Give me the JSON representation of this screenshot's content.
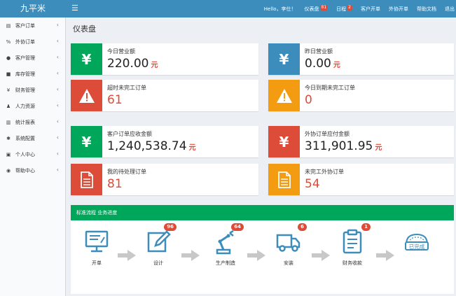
{
  "app": {
    "logo": "九平米"
  },
  "topbar": {
    "menu_icon": "hamburger-icon",
    "greeting": "Hello，李仕！",
    "items": [
      {
        "label": "仪表盘",
        "badge": "81"
      },
      {
        "label": "日程",
        "badge": "2"
      },
      {
        "label": "客户开单",
        "badge": ""
      },
      {
        "label": "外协开单",
        "badge": ""
      },
      {
        "label": "帮助文档",
        "badge": ""
      },
      {
        "label": "退出",
        "badge": ""
      }
    ]
  },
  "sidebar": {
    "items": [
      {
        "label": "客户订单",
        "icon": "file-icon"
      },
      {
        "label": "外协订单",
        "icon": "link-icon"
      },
      {
        "label": "客户管理",
        "icon": "user-icon"
      },
      {
        "label": "库存管理",
        "icon": "box-icon"
      },
      {
        "label": "财务管理",
        "icon": "yen-icon"
      },
      {
        "label": "人力资源",
        "icon": "users-icon"
      },
      {
        "label": "统计报表",
        "icon": "report-icon"
      },
      {
        "label": "系统配置",
        "icon": "gear-icon"
      },
      {
        "label": "个人中心",
        "icon": "card-icon"
      },
      {
        "label": "帮助中心",
        "icon": "help-icon"
      }
    ]
  },
  "page": {
    "title": "仪表盘"
  },
  "stats": {
    "today_revenue": {
      "label": "今日营业额",
      "value": "220.00",
      "unit": "元"
    },
    "yesterday_revenue": {
      "label": "昨日营业额",
      "value": "0.00",
      "unit": "元"
    },
    "overdue_orders": {
      "label": "超时未完工订单",
      "value": "61"
    },
    "due_today_orders": {
      "label": "今日到期未完工订单",
      "value": "0"
    },
    "receivable": {
      "label": "客户订单应收金额",
      "value": "1,240,538.74",
      "unit": "元"
    },
    "payable": {
      "label": "外协订单应付金额",
      "value": "311,901.95",
      "unit": "元"
    },
    "pending_orders": {
      "label": "我的待处理订单",
      "value": "81"
    },
    "unfinished_outsource": {
      "label": "未完工外协订单",
      "value": "54"
    }
  },
  "colors": {
    "green": "#00a65a",
    "blue": "#3c8dbc",
    "red": "#dd4b39",
    "orange": "#f39c12",
    "flow": "#3c8dbc"
  },
  "flow": {
    "title": "标准流程  业务进度",
    "steps": [
      {
        "label": "开单",
        "icon": "monitor-icon",
        "badge": ""
      },
      {
        "label": "设计",
        "icon": "edit-icon",
        "badge": "96"
      },
      {
        "label": "生产制造",
        "icon": "robot-arm-icon",
        "badge": "64"
      },
      {
        "label": "安装",
        "icon": "truck-icon",
        "badge": "6"
      },
      {
        "label": "财务收款",
        "icon": "clipboard-icon",
        "badge": "1"
      },
      {
        "label": "已完成",
        "icon": "completed-stamp-icon",
        "badge": ""
      }
    ]
  }
}
